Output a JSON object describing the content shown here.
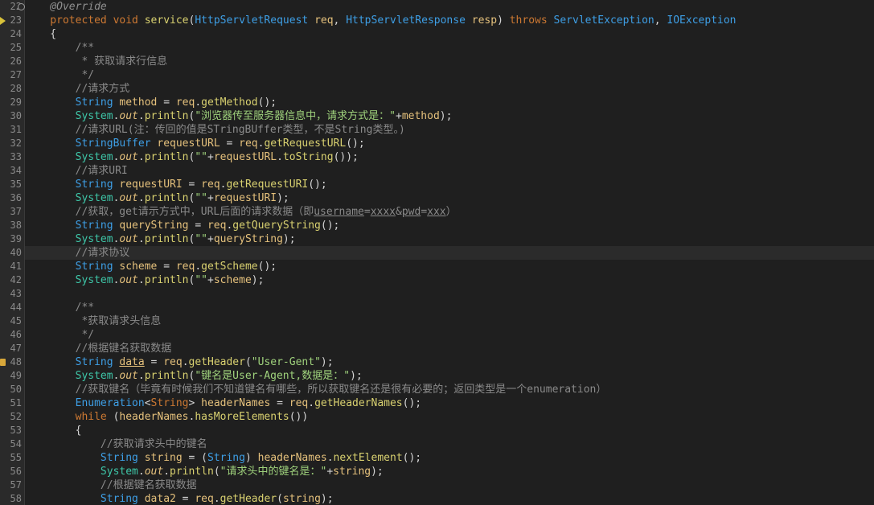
{
  "editor": {
    "line_numbers": [
      "22",
      "23",
      "24",
      "25",
      "26",
      "27",
      "28",
      "29",
      "30",
      "31",
      "32",
      "33",
      "34",
      "35",
      "36",
      "37",
      "38",
      "39",
      "40",
      "41",
      "42",
      "43",
      "44",
      "45",
      "46",
      "47",
      "48",
      "49",
      "50",
      "51",
      "52",
      "53",
      "54",
      "55",
      "56",
      "57",
      "58"
    ],
    "lines": [
      [
        [
          "t-ann",
          "    @Override"
        ]
      ],
      [
        [
          "t-kw",
          "    protected "
        ],
        [
          "t-kw",
          "void "
        ],
        [
          "t-fn",
          "service"
        ],
        [
          "t-plain",
          "("
        ],
        [
          "t-type",
          "HttpServletRequest "
        ],
        [
          "t-var",
          "req"
        ],
        [
          "t-plain",
          ", "
        ],
        [
          "t-type",
          "HttpServletResponse "
        ],
        [
          "t-var",
          "resp"
        ],
        [
          "t-plain",
          ") "
        ],
        [
          "t-kw",
          "throws "
        ],
        [
          "t-type",
          "ServletException"
        ],
        [
          "t-plain",
          ", "
        ],
        [
          "t-type",
          "IOException"
        ]
      ],
      [
        [
          "t-plain",
          "    {"
        ]
      ],
      [
        [
          "t-doc",
          "        /**"
        ]
      ],
      [
        [
          "t-doc",
          "         * 获取请求行信息"
        ]
      ],
      [
        [
          "t-doc",
          "         */"
        ]
      ],
      [
        [
          "t-cmt",
          "        //请求方式"
        ]
      ],
      [
        [
          "t-type",
          "        String "
        ],
        [
          "t-var",
          "method"
        ],
        [
          "t-plain",
          " = "
        ],
        [
          "t-var",
          "req"
        ],
        [
          "t-plain",
          "."
        ],
        [
          "t-fn",
          "getMethod"
        ],
        [
          "t-plain",
          "();"
        ]
      ],
      [
        [
          "t-cls",
          "        System"
        ],
        [
          "t-plain",
          "."
        ],
        [
          "t-italic",
          "out"
        ],
        [
          "t-plain",
          "."
        ],
        [
          "t-fn",
          "println"
        ],
        [
          "t-plain",
          "("
        ],
        [
          "t-str",
          "\"浏览器传至服务器信息中，请求方式是：\""
        ],
        [
          "t-plain",
          "+"
        ],
        [
          "t-var",
          "method"
        ],
        [
          "t-plain",
          ");"
        ]
      ],
      [
        [
          "t-cmt",
          "        //请求URL(注：传回的值是STringBUffer类型，不是String类型。)"
        ]
      ],
      [
        [
          "t-type",
          "        StringBuffer "
        ],
        [
          "t-var",
          "requestURL"
        ],
        [
          "t-plain",
          " = "
        ],
        [
          "t-var",
          "req"
        ],
        [
          "t-plain",
          "."
        ],
        [
          "t-fn",
          "getRequestURL"
        ],
        [
          "t-plain",
          "();"
        ]
      ],
      [
        [
          "t-cls",
          "        System"
        ],
        [
          "t-plain",
          "."
        ],
        [
          "t-italic",
          "out"
        ],
        [
          "t-plain",
          "."
        ],
        [
          "t-fn",
          "println"
        ],
        [
          "t-plain",
          "("
        ],
        [
          "t-str",
          "\"\""
        ],
        [
          "t-plain",
          "+"
        ],
        [
          "t-var",
          "requestURL"
        ],
        [
          "t-plain",
          "."
        ],
        [
          "t-fn",
          "toString"
        ],
        [
          "t-plain",
          "());"
        ]
      ],
      [
        [
          "t-cmt",
          "        //请求URI"
        ]
      ],
      [
        [
          "t-type",
          "        String "
        ],
        [
          "t-var",
          "requestURI"
        ],
        [
          "t-plain",
          " = "
        ],
        [
          "t-var",
          "req"
        ],
        [
          "t-plain",
          "."
        ],
        [
          "t-fn",
          "getRequestURI"
        ],
        [
          "t-plain",
          "();"
        ]
      ],
      [
        [
          "t-cls",
          "        System"
        ],
        [
          "t-plain",
          "."
        ],
        [
          "t-italic",
          "out"
        ],
        [
          "t-plain",
          "."
        ],
        [
          "t-fn",
          "println"
        ],
        [
          "t-plain",
          "("
        ],
        [
          "t-str",
          "\"\""
        ],
        [
          "t-plain",
          "+"
        ],
        [
          "t-var",
          "requestURI"
        ],
        [
          "t-plain",
          ");"
        ]
      ],
      [
        [
          "t-cmt",
          "        //获取，get请示方式中，URL后面的请求数据（即"
        ],
        [
          "t-cmt t-under",
          "username"
        ],
        [
          "t-cmt",
          "="
        ],
        [
          "t-cmt t-under",
          "xxxx"
        ],
        [
          "t-cmt",
          "&"
        ],
        [
          "t-cmt t-under",
          "pwd"
        ],
        [
          "t-cmt",
          "="
        ],
        [
          "t-cmt t-under",
          "xxx"
        ],
        [
          "t-cmt",
          "）"
        ]
      ],
      [
        [
          "t-type",
          "        String "
        ],
        [
          "t-var",
          "queryString"
        ],
        [
          "t-plain",
          " = "
        ],
        [
          "t-var",
          "req"
        ],
        [
          "t-plain",
          "."
        ],
        [
          "t-fn",
          "getQueryString"
        ],
        [
          "t-plain",
          "();"
        ]
      ],
      [
        [
          "t-cls",
          "        System"
        ],
        [
          "t-plain",
          "."
        ],
        [
          "t-italic",
          "out"
        ],
        [
          "t-plain",
          "."
        ],
        [
          "t-fn",
          "println"
        ],
        [
          "t-plain",
          "("
        ],
        [
          "t-str",
          "\"\""
        ],
        [
          "t-plain",
          "+"
        ],
        [
          "t-var",
          "queryString"
        ],
        [
          "t-plain",
          ");"
        ]
      ],
      [
        [
          "t-cmt",
          "        //请求协议"
        ]
      ],
      [
        [
          "t-type",
          "        String "
        ],
        [
          "t-var",
          "scheme"
        ],
        [
          "t-plain",
          " = "
        ],
        [
          "t-var",
          "req"
        ],
        [
          "t-plain",
          "."
        ],
        [
          "t-fn",
          "getScheme"
        ],
        [
          "t-plain",
          "();"
        ]
      ],
      [
        [
          "t-cls",
          "        System"
        ],
        [
          "t-plain",
          "."
        ],
        [
          "t-italic",
          "out"
        ],
        [
          "t-plain",
          "."
        ],
        [
          "t-fn",
          "println"
        ],
        [
          "t-plain",
          "("
        ],
        [
          "t-str",
          "\"\""
        ],
        [
          "t-plain",
          "+"
        ],
        [
          "t-var",
          "scheme"
        ],
        [
          "t-plain",
          ");"
        ]
      ],
      [
        [
          "t-plain",
          ""
        ]
      ],
      [
        [
          "t-doc",
          "        /**"
        ]
      ],
      [
        [
          "t-doc",
          "         *获取请求头信息"
        ]
      ],
      [
        [
          "t-doc",
          "         */"
        ]
      ],
      [
        [
          "t-cmt",
          "        //根据键名获取数据"
        ]
      ],
      [
        [
          "t-type",
          "        String "
        ],
        [
          "t-var t-under",
          "data"
        ],
        [
          "t-plain",
          " = "
        ],
        [
          "t-var",
          "req"
        ],
        [
          "t-plain",
          "."
        ],
        [
          "t-fn",
          "getHeader"
        ],
        [
          "t-plain",
          "("
        ],
        [
          "t-str",
          "\"User-Gent\""
        ],
        [
          "t-plain",
          ");"
        ]
      ],
      [
        [
          "t-cls",
          "        System"
        ],
        [
          "t-plain",
          "."
        ],
        [
          "t-italic",
          "out"
        ],
        [
          "t-plain",
          "."
        ],
        [
          "t-fn",
          "println"
        ],
        [
          "t-plain",
          "("
        ],
        [
          "t-str",
          "\"键名是User-Agent,数据是：\""
        ],
        [
          "t-plain",
          ");"
        ]
      ],
      [
        [
          "t-cmt",
          "        //获取键名（毕竟有时候我们不知道键名有哪些，所以获取键名还是很有必要的；返回类型是一个enumeration）"
        ]
      ],
      [
        [
          "t-type",
          "        Enumeration"
        ],
        [
          "t-plain",
          "<"
        ],
        [
          "t-kw",
          "String"
        ],
        [
          "t-plain",
          "> "
        ],
        [
          "t-var",
          "headerNames"
        ],
        [
          "t-plain",
          " = "
        ],
        [
          "t-var",
          "req"
        ],
        [
          "t-plain",
          "."
        ],
        [
          "t-fn",
          "getHeaderNames"
        ],
        [
          "t-plain",
          "();"
        ]
      ],
      [
        [
          "t-kw",
          "        while "
        ],
        [
          "t-plain",
          "("
        ],
        [
          "t-var",
          "headerNames"
        ],
        [
          "t-plain",
          "."
        ],
        [
          "t-fn",
          "hasMoreElements"
        ],
        [
          "t-plain",
          "())"
        ]
      ],
      [
        [
          "t-plain",
          "        {"
        ]
      ],
      [
        [
          "t-cmt",
          "            //获取请求头中的键名"
        ]
      ],
      [
        [
          "t-type",
          "            String "
        ],
        [
          "t-var",
          "string"
        ],
        [
          "t-plain",
          " = ("
        ],
        [
          "t-type",
          "String"
        ],
        [
          "t-plain",
          ") "
        ],
        [
          "t-var",
          "headerNames"
        ],
        [
          "t-plain",
          "."
        ],
        [
          "t-fn",
          "nextElement"
        ],
        [
          "t-plain",
          "();"
        ]
      ],
      [
        [
          "t-cls",
          "            System"
        ],
        [
          "t-plain",
          "."
        ],
        [
          "t-italic",
          "out"
        ],
        [
          "t-plain",
          "."
        ],
        [
          "t-fn",
          "println"
        ],
        [
          "t-plain",
          "("
        ],
        [
          "t-str",
          "\"请求头中的键名是：\""
        ],
        [
          "t-plain",
          "+"
        ],
        [
          "t-var",
          "string"
        ],
        [
          "t-plain",
          ");"
        ]
      ],
      [
        [
          "t-cmt",
          "            //根据键名获取数据"
        ]
      ],
      [
        [
          "t-type",
          "            String "
        ],
        [
          "t-var",
          "data2"
        ],
        [
          "t-plain",
          " = "
        ],
        [
          "t-var",
          "req"
        ],
        [
          "t-plain",
          "."
        ],
        [
          "t-fn",
          "getHeader"
        ],
        [
          "t-plain",
          "("
        ],
        [
          "t-var",
          "string"
        ],
        [
          "t-plain",
          ");"
        ]
      ]
    ],
    "current_line": "40"
  },
  "colors": {
    "background": "#1f1f1f",
    "gutter": "#2a2a2a",
    "keyword": "#cc7832",
    "type": "#3e9fe6",
    "method": "#d9d170",
    "variable": "#e5c17c",
    "string": "#9fd27c",
    "comment": "#8a8a8a"
  },
  "icons": {
    "line_22": "breakpoint-marker-icon",
    "line_23": "override-marker-icon",
    "line_48": "warning-marker-icon"
  }
}
